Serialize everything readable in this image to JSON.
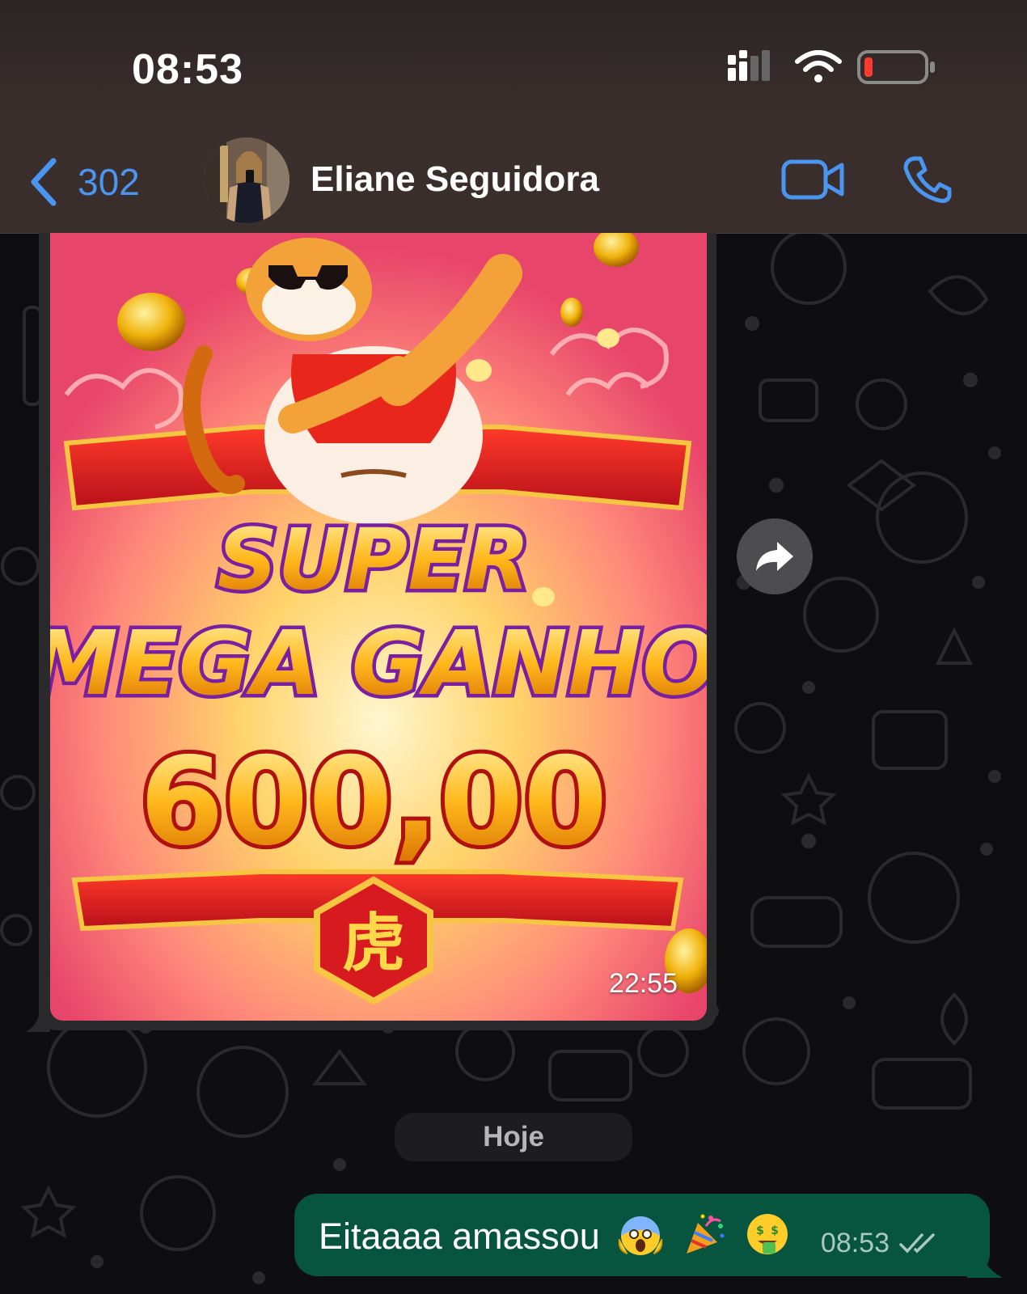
{
  "status_bar": {
    "time": "08:53",
    "signal_icon": "cellular-signal-icon",
    "wifi_icon": "wifi-icon",
    "battery_icon": "battery-low-icon"
  },
  "header": {
    "back_count": "302",
    "contact_name": "Eliane Seguidora",
    "video_icon": "video-call-icon",
    "call_icon": "phone-call-icon",
    "accent_color": "#4a95f0"
  },
  "image_message": {
    "title_line1": "SUPER",
    "title_line2": "MEGA GANHO",
    "amount": "600,00",
    "badge_char": "虎",
    "time": "22:55"
  },
  "date_divider": "Hoje",
  "outgoing_message": {
    "text": "Eitaaaa amassou",
    "emojis": [
      "scream-emoji",
      "party-popper-emoji",
      "money-mouth-emoji"
    ],
    "time": "08:53",
    "status_icon": "double-check-icon",
    "bubble_color": "#07553e"
  }
}
